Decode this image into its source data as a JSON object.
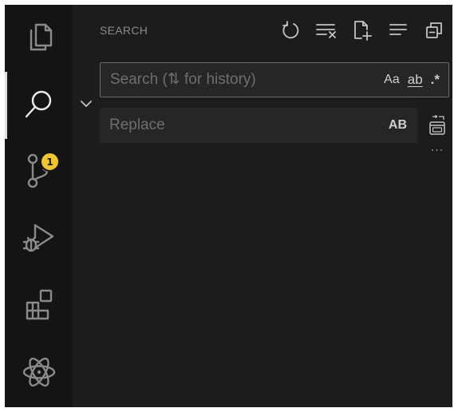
{
  "activity_bar": {
    "items": [
      {
        "id": "explorer",
        "icon": "files-icon"
      },
      {
        "id": "search",
        "icon": "search-icon",
        "active": true
      },
      {
        "id": "source-control",
        "icon": "source-control-icon",
        "badge": "1"
      },
      {
        "id": "run-debug",
        "icon": "run-debug-icon"
      },
      {
        "id": "extensions",
        "icon": "extensions-icon"
      },
      {
        "id": "react",
        "icon": "atom-icon"
      }
    ]
  },
  "search_panel": {
    "title": "SEARCH",
    "header_actions": [
      "refresh-icon",
      "clear-results-icon",
      "new-search-editor-icon",
      "view-as-tree-icon",
      "collapse-all-icon"
    ],
    "search": {
      "placeholder": "Search (⇅ for history)",
      "value": "",
      "options": {
        "match_case": "Aa",
        "whole_word": "ab",
        "regex": ".*"
      }
    },
    "replace": {
      "placeholder": "Replace",
      "value": "",
      "preserve_case": "AB"
    },
    "more": "···"
  },
  "colors": {
    "background": "#1c1c1c",
    "activity_bar": "#141414",
    "input_background": "#262626",
    "input_border": "#6a6a6a",
    "badge": "#f0c630"
  }
}
